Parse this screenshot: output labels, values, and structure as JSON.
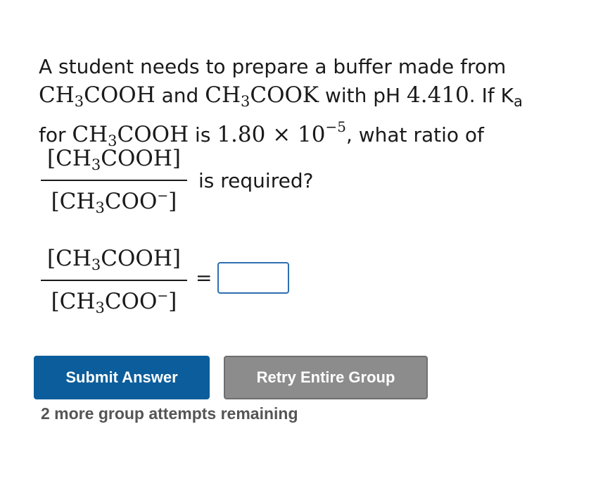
{
  "question": {
    "line1": "A student needs to prepare a buffer made from",
    "acid": "CH",
    "acid_sub": "3",
    "acid_rest": "COOH",
    "and_text": " and ",
    "salt": "CH",
    "salt_sub": "3",
    "salt_rest": "COOK",
    "ph_text": " with pH ",
    "ph_value": "4.410",
    "if_text": ". If K",
    "ka_sub": "a",
    "for_text": "for ",
    "ka_acid": "CH",
    "ka_acid_sub": "3",
    "ka_acid_rest": "COOH",
    "is_text": " is ",
    "ka_value": "1.80 × 10",
    "ka_exp": "−5",
    "ratio_text": ", what ratio of",
    "is_required": "is required?"
  },
  "fraction": {
    "num_open": "[CH",
    "num_sub": "3",
    "num_rest": "COOH]",
    "den_open": "[CH",
    "den_sub": "3",
    "den_rest": "COO",
    "den_sup": "−",
    "den_close": "]"
  },
  "answer": {
    "equals": "=",
    "value": ""
  },
  "buttons": {
    "submit_label": "Submit Answer",
    "retry_label": "Retry Entire Group"
  },
  "status": {
    "attempts_text": "2 more group attempts remaining"
  }
}
